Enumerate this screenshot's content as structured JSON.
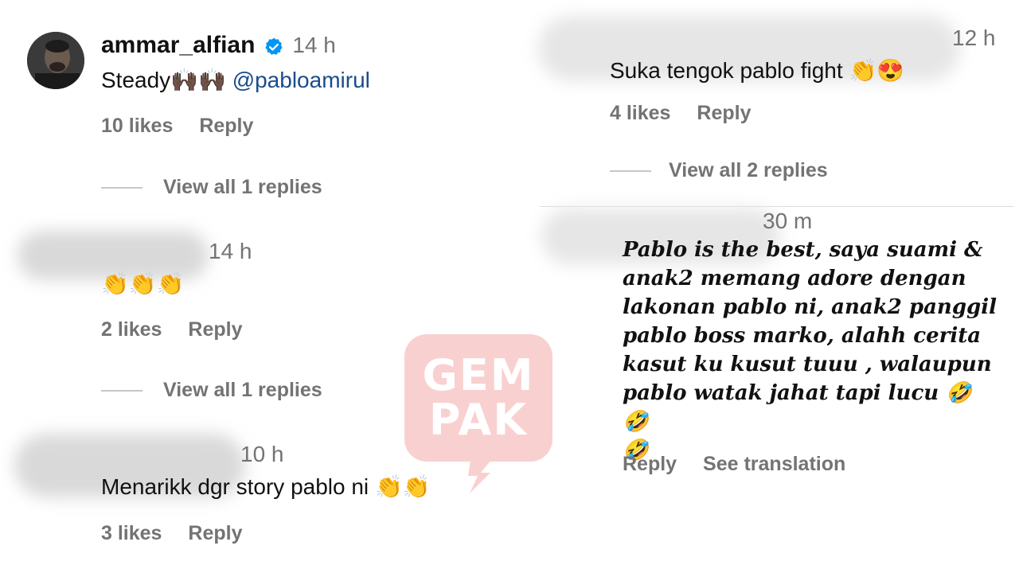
{
  "comments_left": [
    {
      "username": "ammar_alfian",
      "verified": true,
      "time": "14 h",
      "text": "Steady",
      "emoji": "🙌🏿🙌🏿",
      "mention": "@pabloamirul",
      "likes": "10 likes",
      "reply": "Reply",
      "view_replies": "View all 1 replies"
    },
    {
      "time": "14 h",
      "emoji": "👏👏👏",
      "likes": "2 likes",
      "reply": "Reply",
      "view_replies": "View all 1 replies"
    },
    {
      "time": "10 h",
      "text": "Menarikk dgr story pablo ni",
      "emoji": "👏👏",
      "likes": "3 likes",
      "reply": "Reply"
    }
  ],
  "comments_right": [
    {
      "time": "12 h",
      "text": "Suka tengok pablo fight",
      "emoji": "👏😍",
      "likes": "4 likes",
      "reply": "Reply",
      "view_replies": "View all 2 replies"
    },
    {
      "time": "30 m",
      "lines": [
        "Pablo is the best, saya suami &",
        "anak2 memang adore dengan",
        "lakonan pablo ni, anak2 panggil",
        "pablo boss marko, alahh cerita",
        "kasut ku kusut tuuu , walaupun",
        "pablo watak jahat tapi lucu 🤣🤣",
        "🤣"
      ],
      "reply": "Reply",
      "see_translation": "See translation"
    }
  ],
  "watermark": {
    "line1": "GEM",
    "line2": "PAK",
    "color": "#f9c8c8"
  },
  "icons": {
    "verified": "verified-badge-icon",
    "avatar": "avatar"
  },
  "colors": {
    "meta_gray": "#737373",
    "mention_blue": "#1a4c8c",
    "verified_blue": "#0095f6"
  }
}
